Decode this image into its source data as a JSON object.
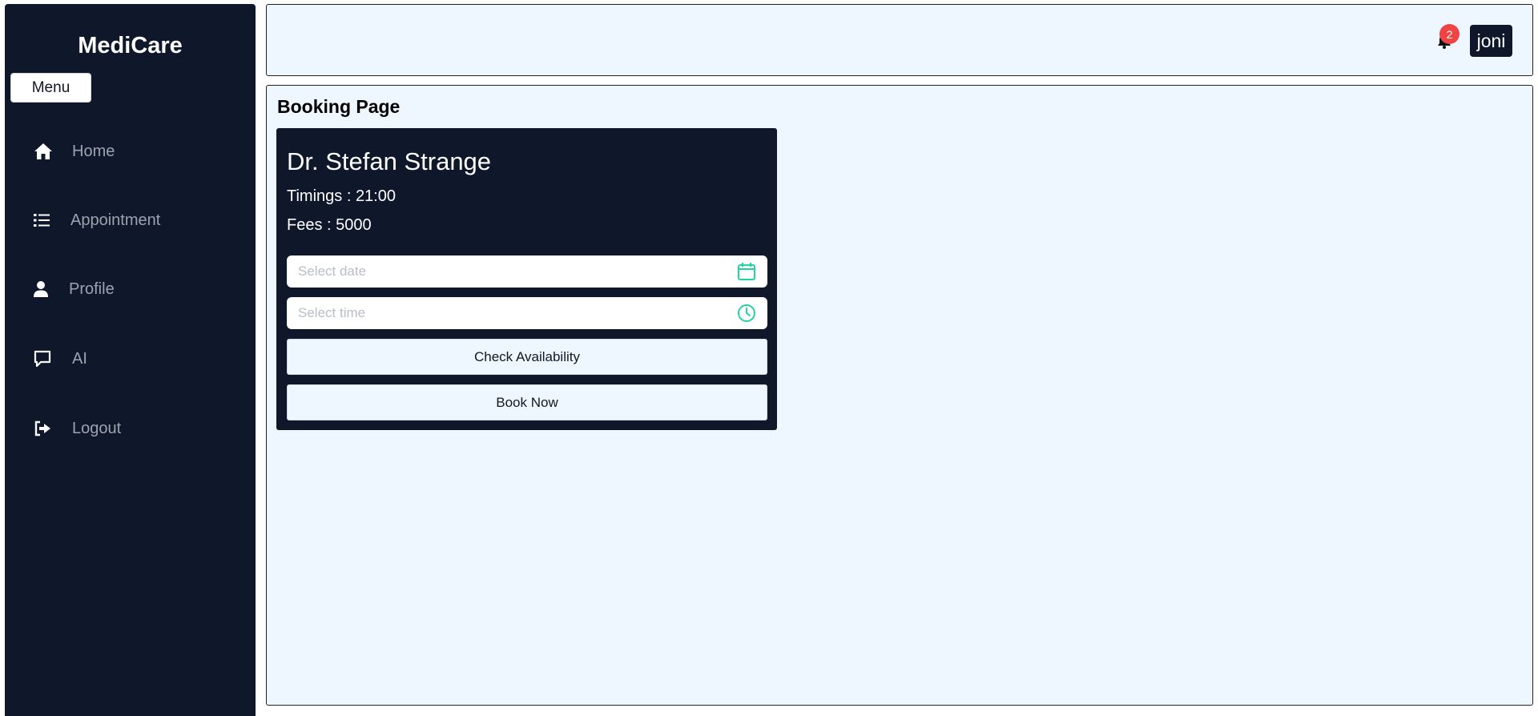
{
  "app": {
    "brand": "MediCare"
  },
  "sidebar": {
    "menu_label": "Menu",
    "items": [
      {
        "label": "Home",
        "icon": "home-icon"
      },
      {
        "label": "Appointment",
        "icon": "list-icon"
      },
      {
        "label": "Profile",
        "icon": "user-icon"
      },
      {
        "label": "AI",
        "icon": "chat-icon"
      },
      {
        "label": "Logout",
        "icon": "logout-icon"
      }
    ]
  },
  "header": {
    "notification_count": "2",
    "user_name": "joni"
  },
  "main": {
    "page_title": "Booking Page",
    "card": {
      "doctor_name": "Dr. Stefan Strange",
      "timings": "Timings : 21:00",
      "fees": "Fees : 5000",
      "date_placeholder": "Select date",
      "time_placeholder": "Select time",
      "check_label": "Check Availability",
      "book_label": "Book Now"
    }
  },
  "colors": {
    "sidebar_bg": "#0f172a",
    "panel_bg": "#eef6ff",
    "accent_green": "#22d3a6",
    "badge_red": "#ef4444"
  }
}
